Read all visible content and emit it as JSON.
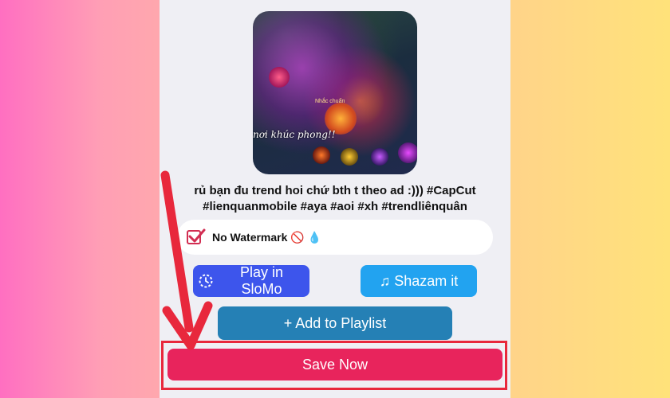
{
  "video": {
    "overlay_text": "nơi khúc phong!!",
    "tag_text": "Nhắc chuẩn"
  },
  "caption": {
    "line1": "rủ bạn đu trend hoi chứ bth t theo ad :))) #CapCut",
    "line2": "#lienquanmobile #aya #aoi #xh #trendliênquân"
  },
  "watermark": {
    "label": "No Watermark 🚫 💧",
    "checked": true
  },
  "buttons": {
    "slomo_label": "Play in SloMo",
    "shazam_label": "♫ Shazam it",
    "playlist_label": "+ Add to Playlist",
    "save_label": "Save Now"
  },
  "colors": {
    "save": "#e8245c",
    "slomo": "#3d55ec",
    "shazam": "#22a3f0",
    "playlist": "#2580b5",
    "annotation": "#e8283c"
  }
}
